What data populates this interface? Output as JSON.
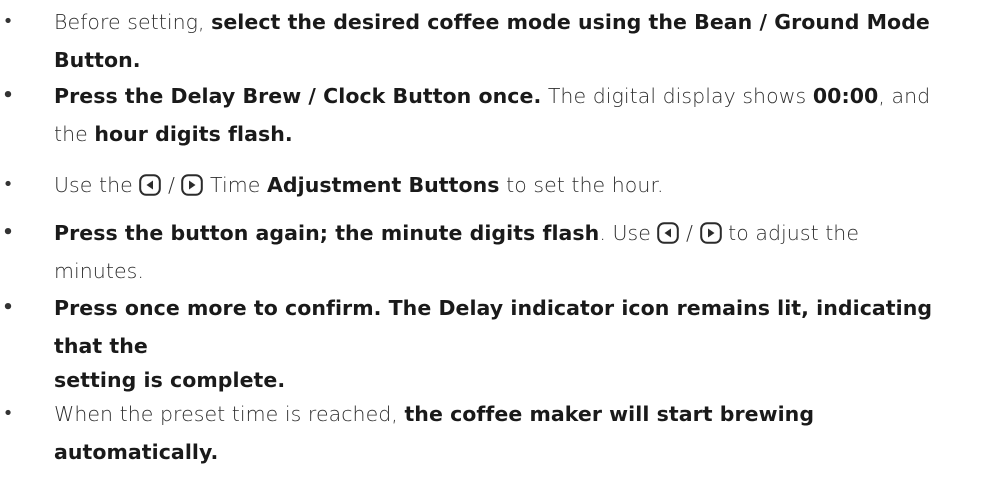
{
  "items": [
    {
      "bullet": "•",
      "lines": [
        [
          {
            "t": "Before setting, ",
            "b": false
          },
          {
            "t": "select the desired coffee mode using the Bean / Ground Mode",
            "b": true
          }
        ],
        [
          {
            "t": "Button.",
            "b": true
          }
        ]
      ]
    },
    {
      "bullet": "•",
      "lines": [
        [
          {
            "t": "Press the Delay Brew / Clock Button once.",
            "b": true
          },
          {
            "t": " The digital display shows ",
            "b": false
          },
          {
            "t": "00:00",
            "b": true
          },
          {
            "t": ", and",
            "b": false
          }
        ],
        [
          {
            "t": "the ",
            "b": false
          },
          {
            "t": "hour digits flash.",
            "b": true
          }
        ]
      ]
    },
    {
      "bullet": "•",
      "lines": [
        [
          {
            "t": "Use the ",
            "b": false
          },
          {
            "icon": "left-arrow-icon"
          },
          {
            "t": " / ",
            "b": false
          },
          {
            "icon": "right-arrow-icon"
          },
          {
            "t": " Time ",
            "b": false
          },
          {
            "t": "Adjustment Buttons",
            "b": true
          },
          {
            "t": " to set the hour.",
            "b": false
          }
        ]
      ]
    },
    {
      "bullet": "•",
      "lines": [
        [
          {
            "t": "Press the button again; the minute digits flash",
            "b": true
          },
          {
            "t": ". Use ",
            "b": false
          },
          {
            "icon": "left-arrow-icon"
          },
          {
            "t": " / ",
            "b": false
          },
          {
            "icon": "right-arrow-icon"
          },
          {
            "t": " to adjust the",
            "b": false
          }
        ],
        [
          {
            "t": "minutes.",
            "b": false
          }
        ]
      ]
    },
    {
      "bullet": "•",
      "lines": [
        [
          {
            "t": "Press once more to confirm. The Delay indicator icon remains lit, indicating",
            "b": true
          }
        ],
        [
          {
            "t": "that the",
            "b": true
          }
        ],
        [
          {
            "t": "setting is complete.",
            "b": true
          }
        ]
      ]
    },
    {
      "bullet": "•",
      "lines": [
        [
          {
            "t": "When the preset time is reached, ",
            "b": false
          },
          {
            "t": "the coffee maker will start brewing",
            "b": true
          }
        ],
        [
          {
            "t": "automatically.",
            "b": true
          }
        ]
      ]
    }
  ],
  "colors": {
    "text": "#2e2e2e",
    "bold_text": "#1a1a1a",
    "icon_stroke": "#2b2b2b"
  }
}
